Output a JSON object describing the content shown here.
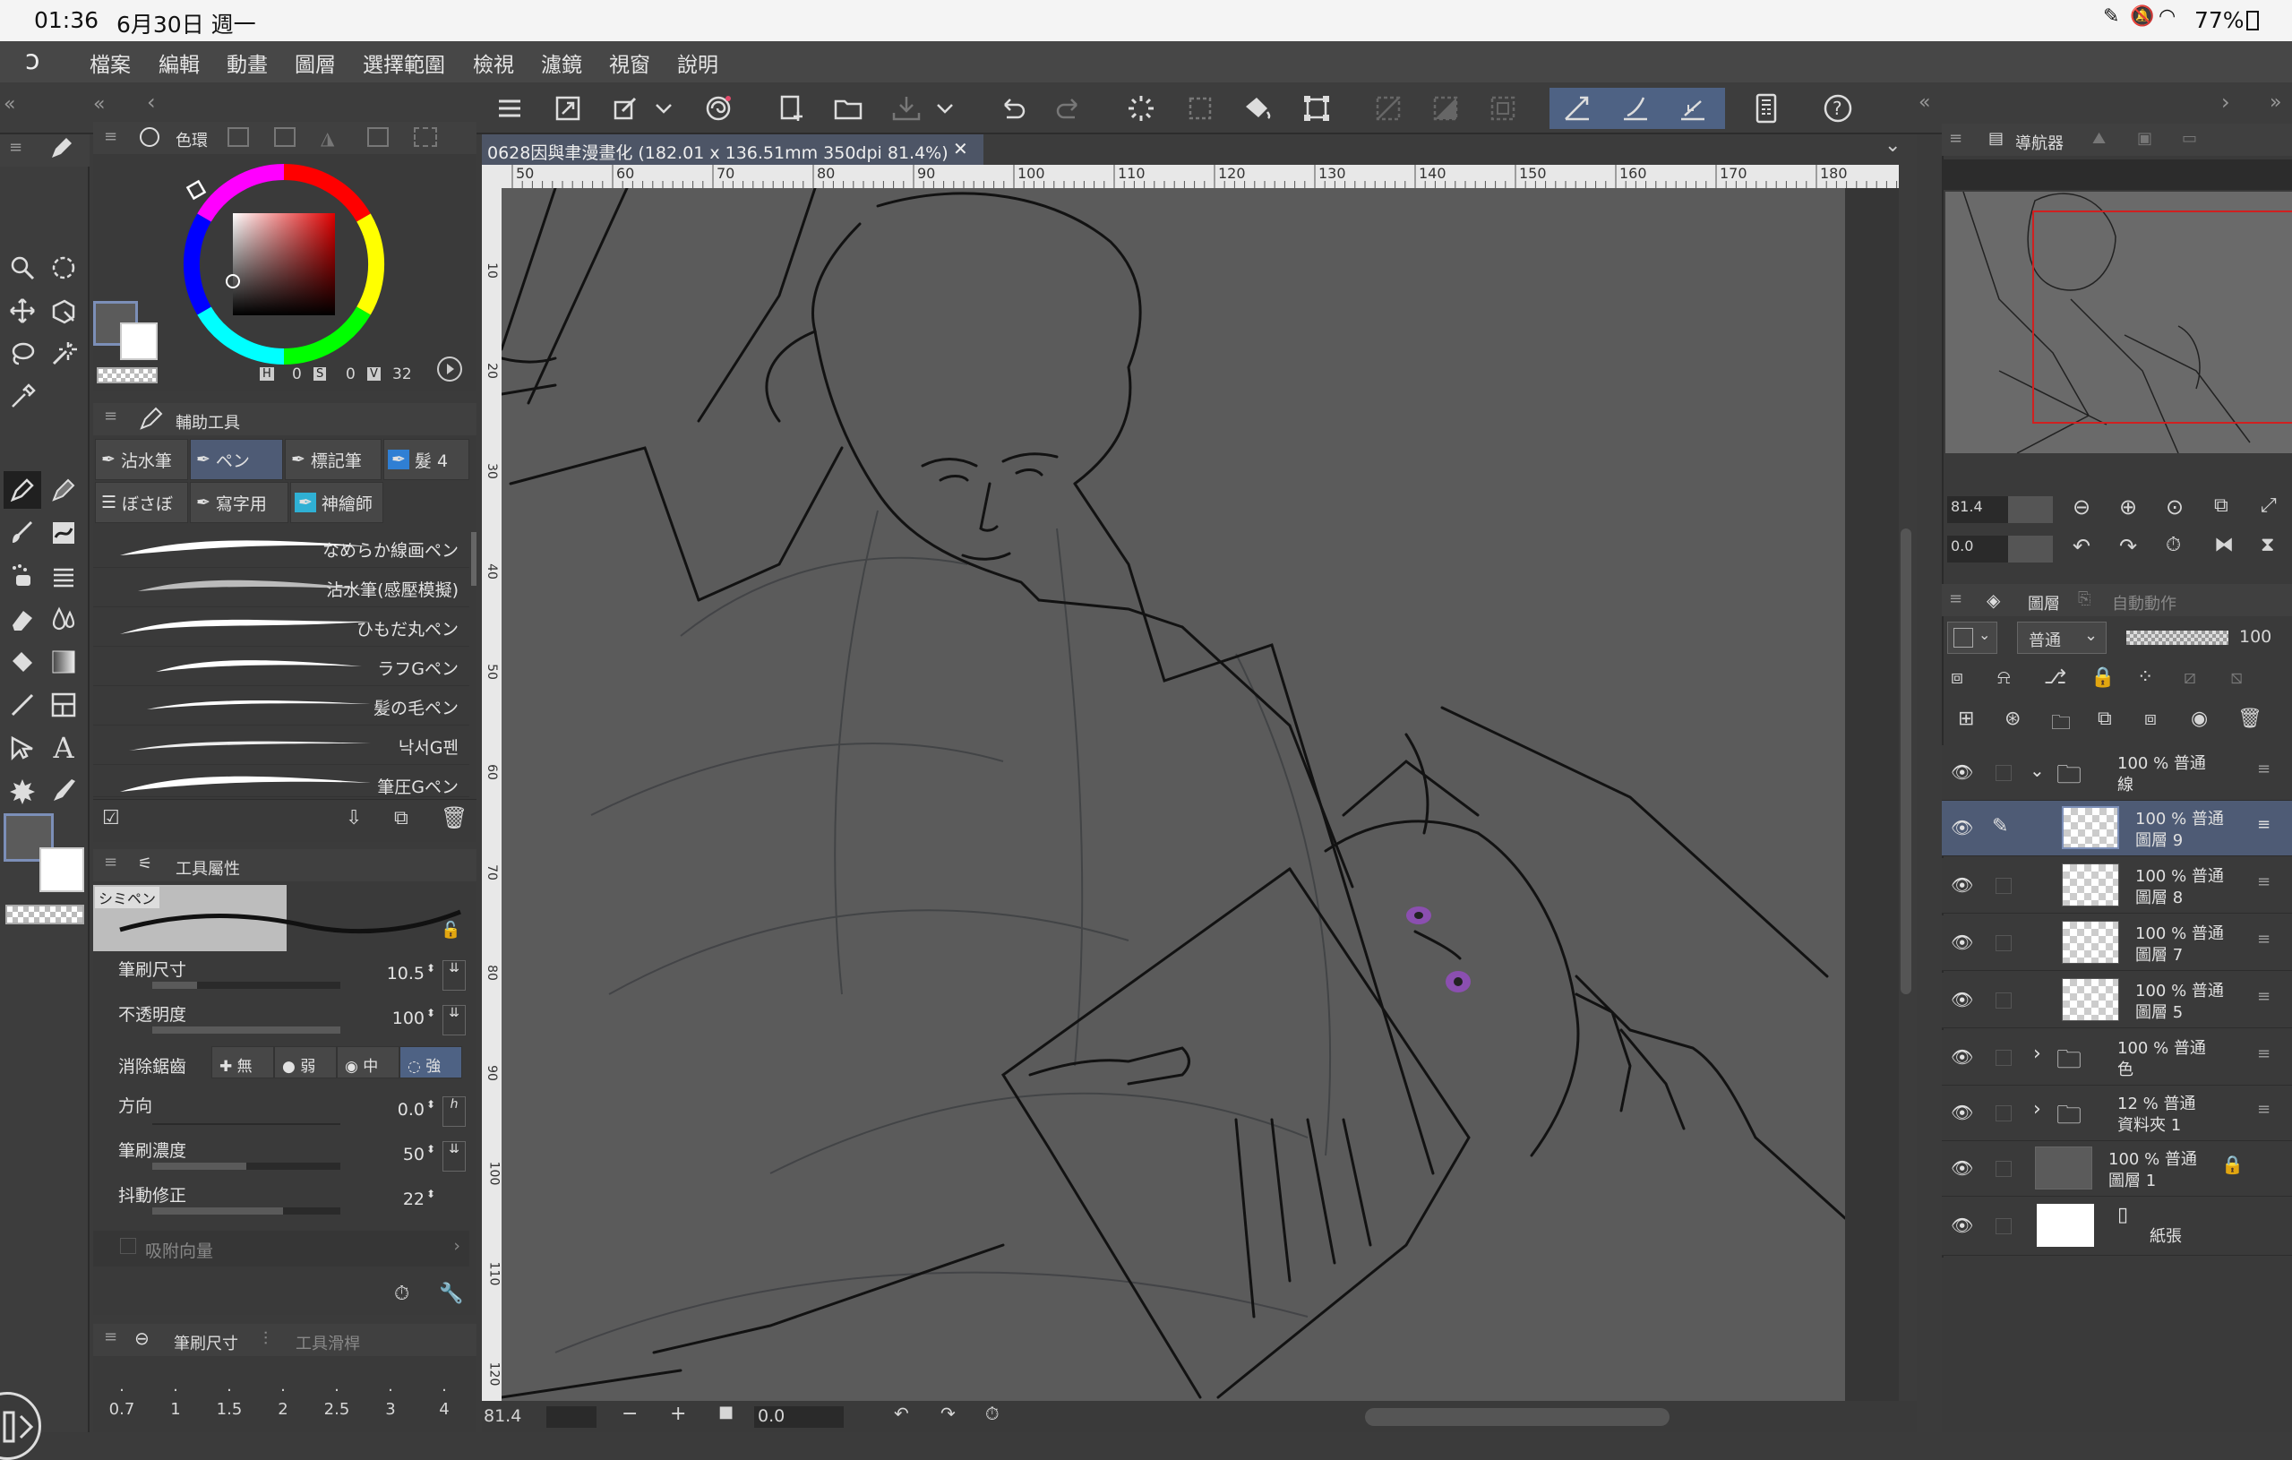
{
  "status": {
    "time": "01:36",
    "date": "6月30日 週一",
    "battery": "77%"
  },
  "menu": {
    "items": [
      "檔案",
      "編輯",
      "動畫",
      "圖層",
      "選擇範圍",
      "檢視",
      "濾鏡",
      "視窗",
      "說明"
    ]
  },
  "color_panel": {
    "tab_label": "色環",
    "h_label": "H",
    "h_value": "0",
    "s_label": "S",
    "s_value": "0",
    "v_label": "V",
    "v_value": "32"
  },
  "subtool_panel": {
    "title": "輔助工具",
    "groups": [
      "沾水筆",
      "ペン",
      "標記筆",
      "髮 4",
      "ぼさぼ",
      "寫字用",
      "神繪師"
    ],
    "brushes": [
      "なめらか線画ペン",
      "沾水筆(感壓模擬)",
      "ひもだ丸ペン",
      "ラフGペン",
      "髪の毛ペン",
      "낙서G펜",
      "筆圧Gペン"
    ]
  },
  "tool_property": {
    "title": "工具屬性",
    "brush_name": "シミペン",
    "brush_size_label": "筆刷尺寸",
    "brush_size_value": "10.5",
    "opacity_label": "不透明度",
    "opacity_value": "100",
    "antialias_label": "消除鋸齒",
    "antialias_options": [
      "無",
      "弱",
      "中",
      "強"
    ],
    "direction_label": "方向",
    "direction_value": "0.0",
    "density_label": "筆刷濃度",
    "density_value": "50",
    "stabilization_label": "抖動修正",
    "stabilization_value": "22",
    "snap_label": "吸附向量"
  },
  "brush_size_panel": {
    "tab1": "筆刷尺寸",
    "tab2": "工具滑桿",
    "sizes": [
      "0.7",
      "1",
      "1.5",
      "2",
      "2.5",
      "3",
      "4"
    ]
  },
  "document": {
    "tab_title": "0628因與聿漫畫化 (182.01 x 136.51mm 350dpi 81.4%)"
  },
  "ruler": {
    "top": [
      "50",
      "60",
      "70",
      "80",
      "90",
      "100",
      "110",
      "120",
      "130",
      "140",
      "150",
      "160",
      "170",
      "180"
    ],
    "left": [
      "10",
      "20",
      "30",
      "40",
      "50",
      "60",
      "70",
      "80",
      "90",
      "100",
      "110",
      "120"
    ]
  },
  "bottom_bar": {
    "zoom": "81.4",
    "angle": "0.0"
  },
  "navigator": {
    "tab": "導航器",
    "zoom": "81.4",
    "angle": "0.0"
  },
  "layers_panel": {
    "tab": "圖層",
    "tab2": "自動動作",
    "blend_mode": "普通",
    "opacity": "100",
    "layers": [
      {
        "mode": "100 % 普通",
        "name": "線"
      },
      {
        "mode": "100 % 普通",
        "name": "圖層 9"
      },
      {
        "mode": "100 % 普通",
        "name": "圖層 8"
      },
      {
        "mode": "100 % 普通",
        "name": "圖層 7"
      },
      {
        "mode": "100 % 普通",
        "name": "圖層 5"
      },
      {
        "mode": "100 % 普通",
        "name": "色"
      },
      {
        "mode": "12 % 普通",
        "name": "資料夾 1"
      },
      {
        "mode": "100 % 普通",
        "name": "圖層 1"
      },
      {
        "mode": "",
        "name": "紙張"
      }
    ]
  },
  "colors": {
    "accent": "#4e5b75",
    "panel": "#3a3a3a",
    "canvas": "#5b5b5b"
  }
}
